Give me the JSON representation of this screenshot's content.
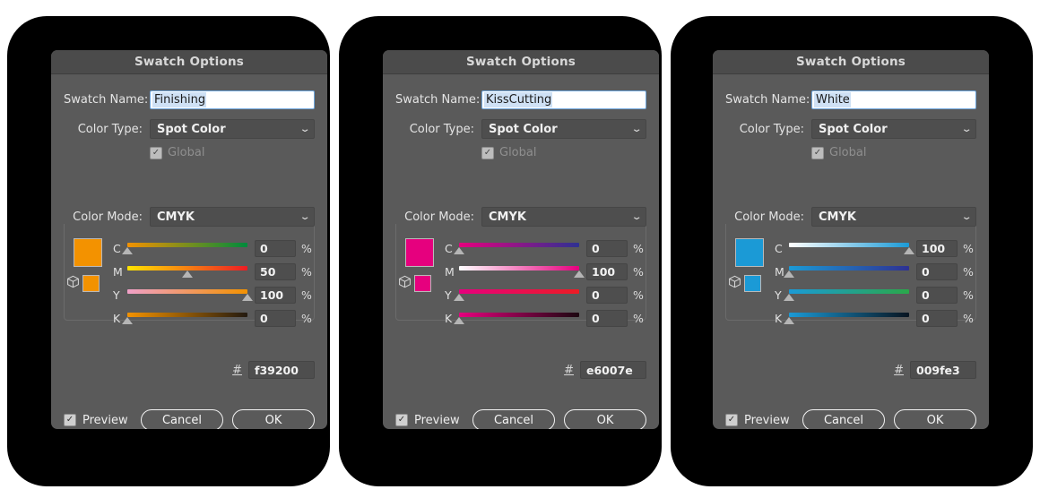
{
  "window": {
    "title": "Swatch Options"
  },
  "labels": {
    "swatch_name": "Swatch Name:",
    "color_type": "Color Type:",
    "global": "Global",
    "color_mode": "Color Mode:",
    "preview": "Preview",
    "cancel": "Cancel",
    "ok": "OK",
    "hash": "#",
    "percent": "%",
    "chevron": "⌄",
    "check": "✓"
  },
  "channels": [
    "C",
    "M",
    "Y",
    "K"
  ],
  "dialogs": [
    {
      "title": "Swatch Options",
      "swatch_name": "Finishing",
      "color_type": "Spot Color",
      "global_checked": true,
      "color_mode": "CMYK",
      "hex": "f39200",
      "preview_checked": true,
      "swatch_color": "#f39200",
      "values": [
        0,
        50,
        100,
        0
      ],
      "tracks": [
        {
          "channel": "C",
          "from": "#f39200",
          "to": "#008a3c"
        },
        {
          "channel": "M",
          "from": "#ffe400",
          "to": "#ec1c24"
        },
        {
          "channel": "Y",
          "from": "#f0a0c8",
          "to": "#f39200"
        },
        {
          "channel": "K",
          "from": "#f39200",
          "to": "#231a10"
        }
      ]
    },
    {
      "title": "Swatch Options",
      "swatch_name": "KissCutting",
      "color_type": "Spot Color",
      "global_checked": true,
      "color_mode": "CMYK",
      "hex": "e6007e",
      "preview_checked": true,
      "swatch_color": "#e6007e",
      "values": [
        0,
        100,
        0,
        0
      ],
      "tracks": [
        {
          "channel": "C",
          "from": "#e6007e",
          "to": "#2e3192"
        },
        {
          "channel": "M",
          "from": "#ffffff",
          "to": "#e6007e"
        },
        {
          "channel": "Y",
          "from": "#e6007e",
          "to": "#ed1c24"
        },
        {
          "channel": "K",
          "from": "#e6007e",
          "to": "#1c0710"
        }
      ]
    },
    {
      "title": "Swatch Options",
      "swatch_name": "White",
      "color_type": "Spot Color",
      "global_checked": true,
      "color_mode": "CMYK",
      "hex": "009fe3",
      "preview_checked": true,
      "swatch_color": "#1b9ad6",
      "values": [
        100,
        0,
        0,
        0
      ],
      "tracks": [
        {
          "channel": "C",
          "from": "#ffffff",
          "to": "#1b9ad6"
        },
        {
          "channel": "M",
          "from": "#1b9ad6",
          "to": "#2e3192"
        },
        {
          "channel": "Y",
          "from": "#1b9ad6",
          "to": "#2aa84a"
        },
        {
          "channel": "K",
          "from": "#1b9ad6",
          "to": "#081420"
        }
      ]
    }
  ]
}
